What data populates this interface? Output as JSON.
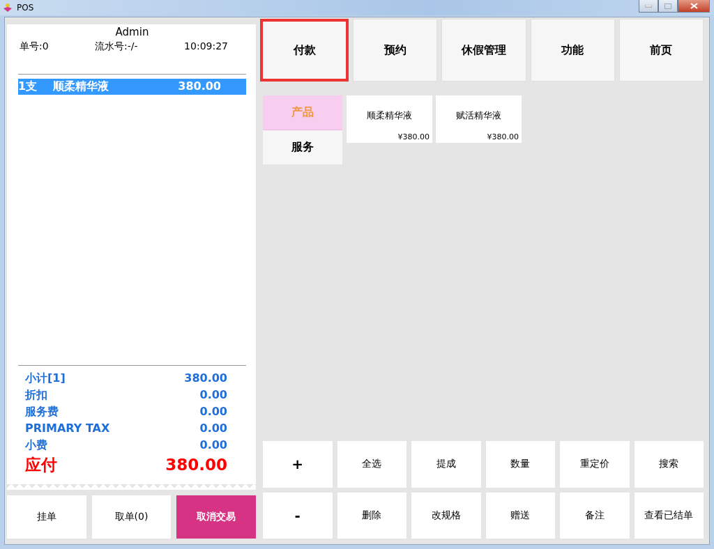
{
  "window": {
    "title": "POS"
  },
  "receipt": {
    "user": "Admin",
    "order_no": "单号:0",
    "serial_no": "流水号:-/-",
    "time": "10:09:27",
    "lines": [
      {
        "qty": "1支",
        "name": "顺柔精华液",
        "amount": "380.00",
        "selected": true
      }
    ],
    "summary": [
      {
        "label": "小计[1]",
        "value": "380.00",
        "kind": "normal"
      },
      {
        "label": "折扣",
        "value": "0.00",
        "kind": "normal"
      },
      {
        "label": "服务费",
        "value": "0.00",
        "kind": "normal"
      },
      {
        "label": "PRIMARY TAX",
        "value": "0.00",
        "kind": "normal"
      },
      {
        "label": "小费",
        "value": "0.00",
        "kind": "normal"
      },
      {
        "label": "应付",
        "value": "380.00",
        "kind": "total"
      }
    ]
  },
  "order_buttons": [
    {
      "label": "挂单",
      "kind": "plain"
    },
    {
      "label": "取单(0)",
      "kind": "plain"
    },
    {
      "label": "取消交易",
      "kind": "danger"
    }
  ],
  "nav_buttons": [
    {
      "label": "付款",
      "selected": true
    },
    {
      "label": "预约",
      "selected": false
    },
    {
      "label": "休假管理",
      "selected": false
    },
    {
      "label": "功能",
      "selected": false
    },
    {
      "label": "前页",
      "selected": false
    }
  ],
  "categories": [
    {
      "label": "产品",
      "selected": true
    },
    {
      "label": "服务",
      "selected": false
    }
  ],
  "products": [
    {
      "name": "顺柔精华液",
      "price": "¥380.00"
    },
    {
      "name": "赋活精华液",
      "price": "¥380.00"
    }
  ],
  "keypad": [
    "+",
    "全选",
    "提成",
    "数量",
    "重定价",
    "搜索",
    "-",
    "删除",
    "改规格",
    "赠送",
    "备注",
    "查看已结单"
  ]
}
